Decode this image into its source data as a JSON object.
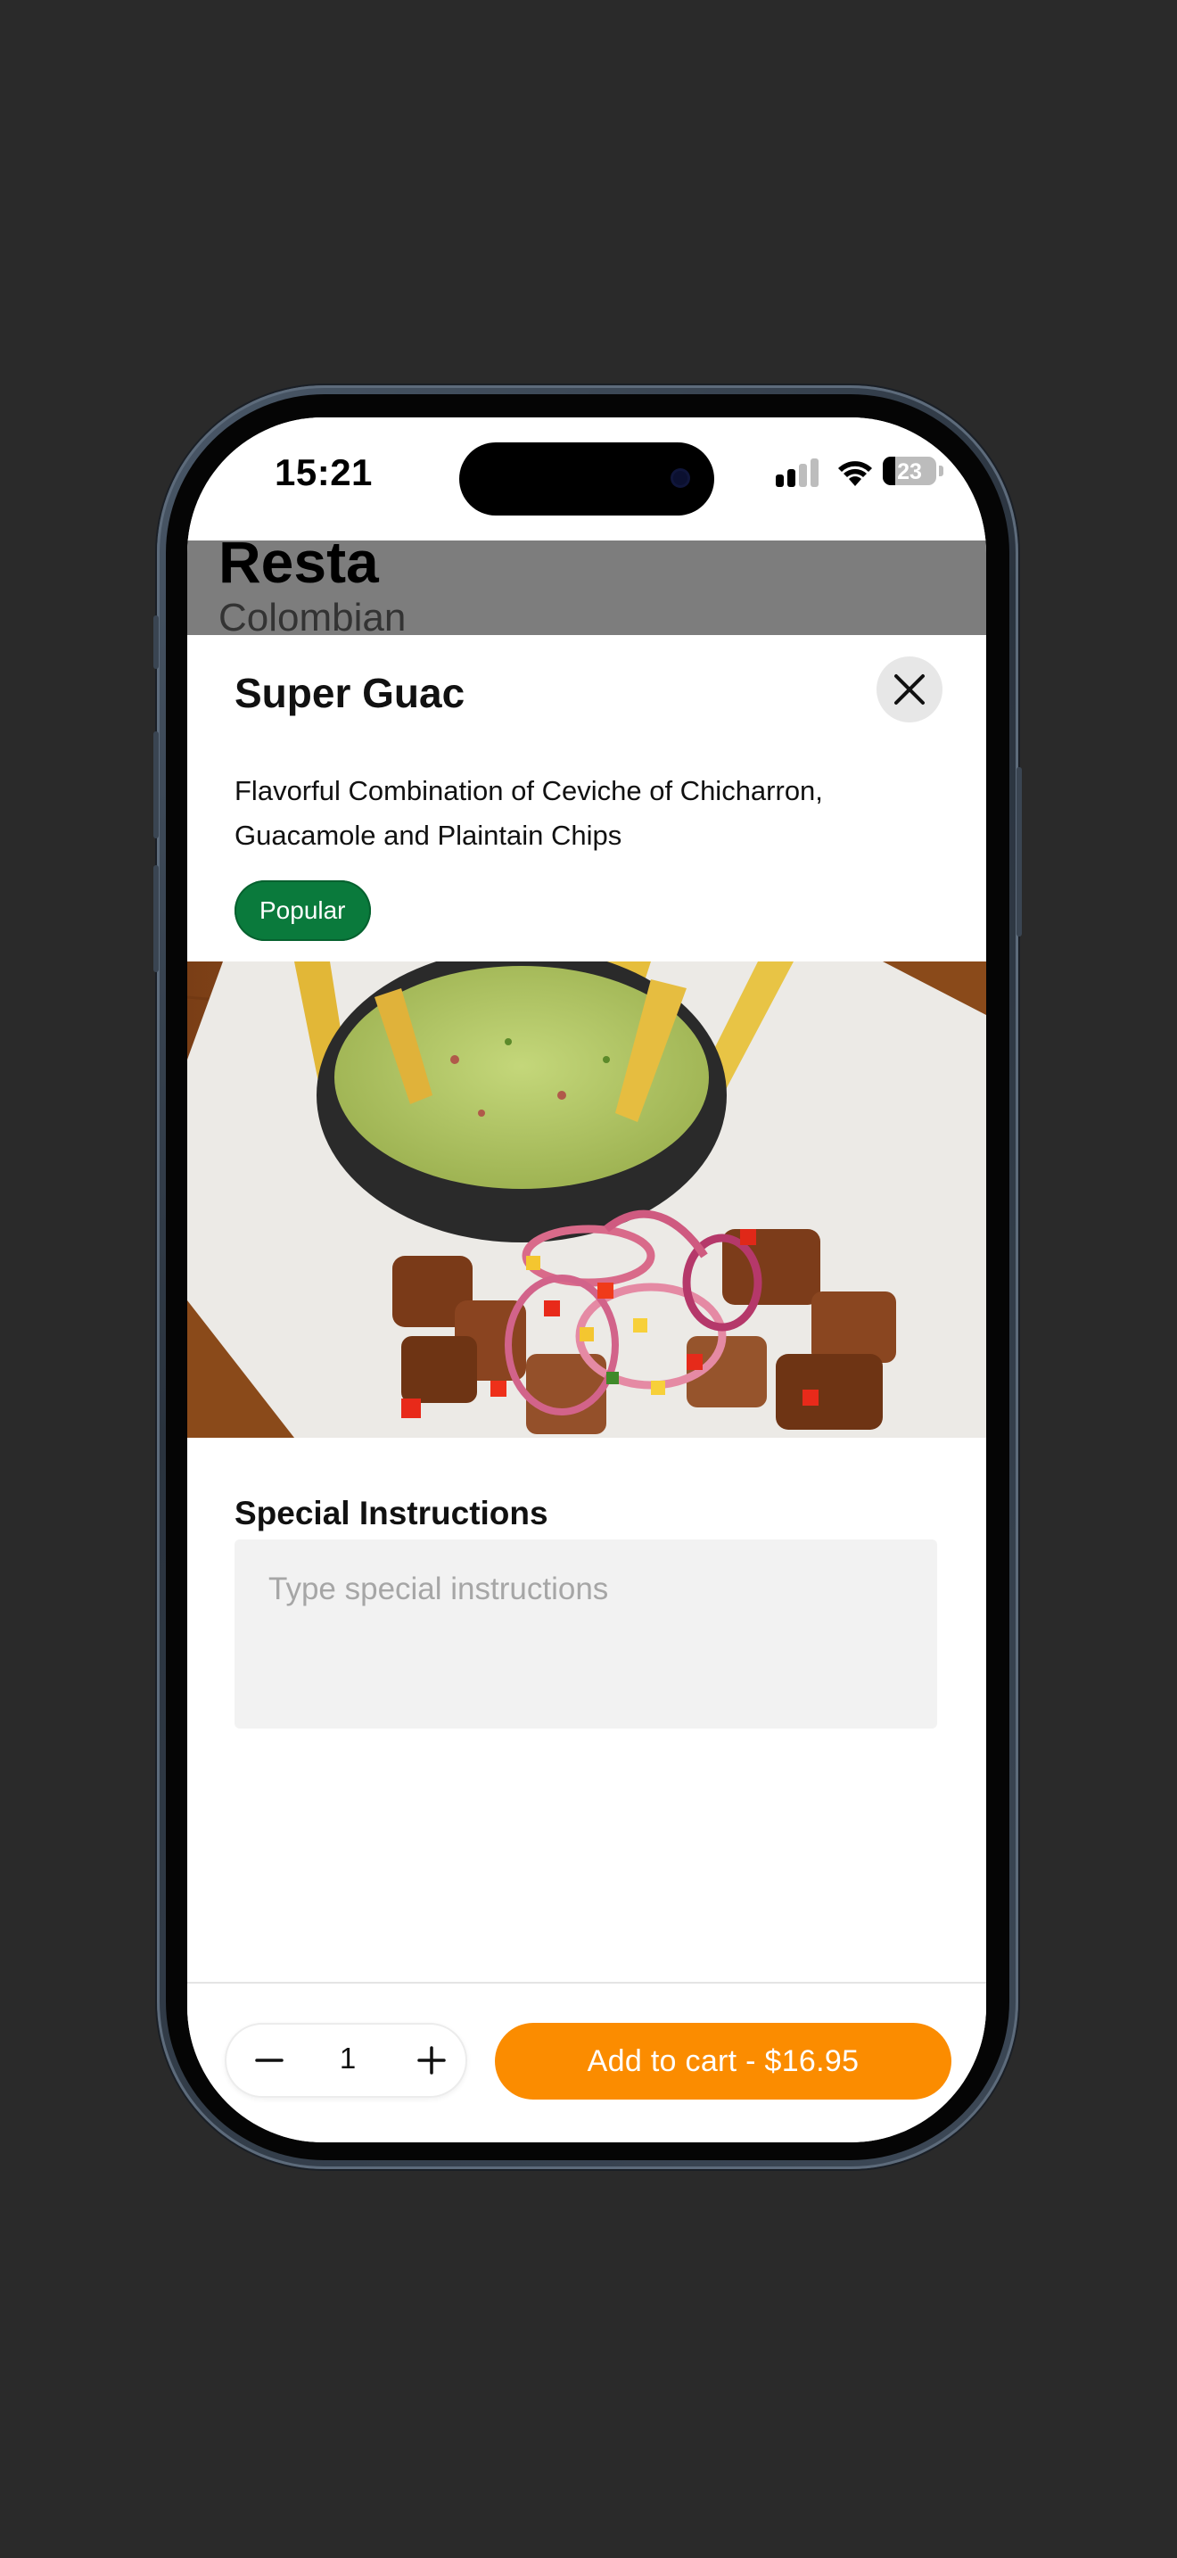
{
  "status_bar": {
    "time": "15:21",
    "battery": "23",
    "battery_level": 0.23,
    "icons": [
      "signal-icon",
      "wifi-icon",
      "battery-icon"
    ]
  },
  "background_page": {
    "restaurant_name": "Resta",
    "cuisine": "Colombian"
  },
  "item": {
    "title": "Super Guac",
    "description": "Flavorful Combination of Ceviche of Chicharron, Guacamole and Plaintain Chips",
    "badge": "Popular"
  },
  "special_instructions": {
    "title": "Special Instructions",
    "placeholder": "Type special instructions",
    "value": ""
  },
  "footer": {
    "quantity": "1",
    "add_to_cart_label": "Add to cart - $16.95"
  },
  "colors": {
    "accent": "#fb8c00",
    "badge": "#0a7a3c",
    "backdrop": "#2a2a2a"
  }
}
